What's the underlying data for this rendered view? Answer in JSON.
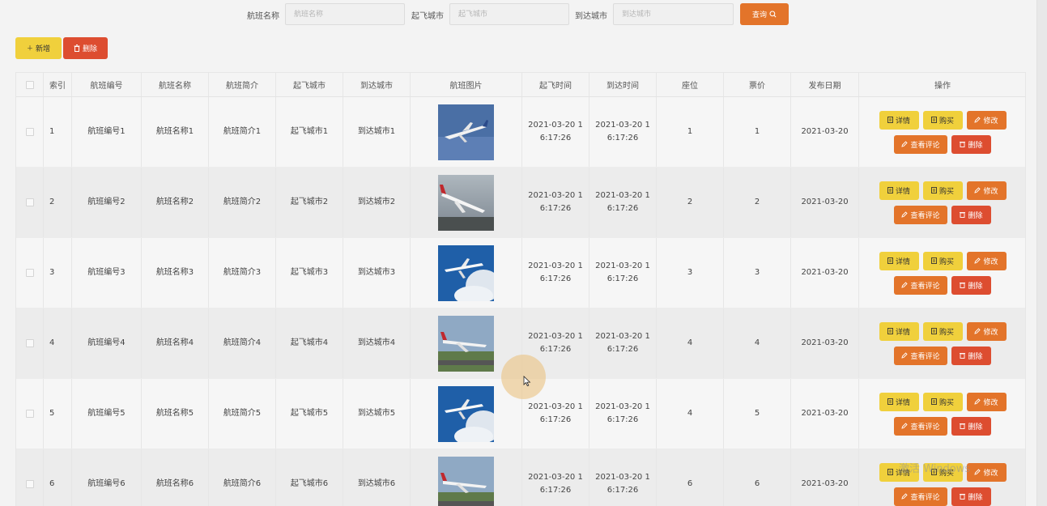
{
  "search": {
    "fields": [
      {
        "label": "航班名称",
        "placeholder": "航班名称"
      },
      {
        "label": "起飞城市",
        "placeholder": "起飞城市"
      },
      {
        "label": "到达城市",
        "placeholder": "到达城市"
      }
    ],
    "query_label": "查询"
  },
  "toolbar": {
    "add_label": "新增",
    "delete_label": "删除"
  },
  "table": {
    "headers": [
      "索引",
      "航班编号",
      "航班名称",
      "航班简介",
      "起飞城市",
      "到达城市",
      "航班图片",
      "起飞时间",
      "到达时间",
      "座位",
      "票价",
      "发布日期",
      "操作"
    ],
    "rows": [
      {
        "index": "1",
        "code": "航班编号1",
        "name": "航班名称1",
        "intro": "航班简介1",
        "from": "起飞城市1",
        "to": "到达城市1",
        "depart": "2021-03-20 16:17:26",
        "arrive": "2021-03-20 16:17:26",
        "seats": "1",
        "price": "1",
        "date": "2021-03-20"
      },
      {
        "index": "2",
        "code": "航班编号2",
        "name": "航班名称2",
        "intro": "航班简介2",
        "from": "起飞城市2",
        "to": "到达城市2",
        "depart": "2021-03-20 16:17:26",
        "arrive": "2021-03-20 16:17:26",
        "seats": "2",
        "price": "2",
        "date": "2021-03-20"
      },
      {
        "index": "3",
        "code": "航班编号3",
        "name": "航班名称3",
        "intro": "航班简介3",
        "from": "起飞城市3",
        "to": "到达城市3",
        "depart": "2021-03-20 16:17:26",
        "arrive": "2021-03-20 16:17:26",
        "seats": "3",
        "price": "3",
        "date": "2021-03-20"
      },
      {
        "index": "4",
        "code": "航班编号4",
        "name": "航班名称4",
        "intro": "航班简介4",
        "from": "起飞城市4",
        "to": "到达城市4",
        "depart": "2021-03-20 16:17:26",
        "arrive": "2021-03-20 16:17:26",
        "seats": "4",
        "price": "4",
        "date": "2021-03-20"
      },
      {
        "index": "5",
        "code": "航班编号5",
        "name": "航班名称5",
        "intro": "航班简介5",
        "from": "起飞城市5",
        "to": "到达城市5",
        "depart": "2021-03-20 16:17:26",
        "arrive": "2021-03-20 16:17:26",
        "seats": "4",
        "price": "5",
        "date": "2021-03-20"
      },
      {
        "index": "6",
        "code": "航班编号6",
        "name": "航班名称6",
        "intro": "航班简介6",
        "from": "起飞城市6",
        "to": "到达城市6",
        "depart": "2021-03-20 16:17:26",
        "arrive": "2021-03-20 16:17:26",
        "seats": "6",
        "price": "6",
        "date": "2021-03-20"
      }
    ],
    "actions": {
      "detail": "详情",
      "buy": "购买",
      "edit": "修改",
      "review": "查看评论",
      "delete": "删除"
    }
  },
  "watermark": "激活 Windows",
  "colors": {
    "yellow": "#f0d03c",
    "orange": "#e3742a",
    "red": "#dd4d30"
  },
  "icons": {
    "add": "plus-icon",
    "delete": "trash-icon",
    "query": "search-icon",
    "detail": "document-icon",
    "buy": "document-icon",
    "edit": "pencil-icon",
    "review": "pencil-icon"
  }
}
